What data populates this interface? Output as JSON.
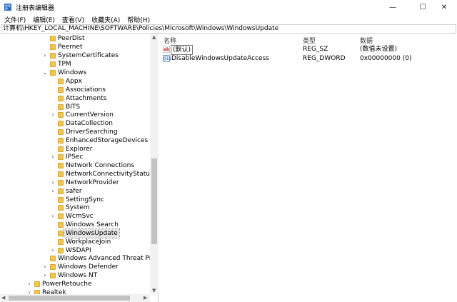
{
  "window": {
    "title": "注册表编辑器"
  },
  "window_controls": {
    "minimize": "—",
    "maximize": "☐",
    "close": "✕"
  },
  "menu": [
    "文件(F)",
    "编辑(E)",
    "查看(V)",
    "收藏夹(A)",
    "帮助(H)"
  ],
  "address": "计算机\\HKEY_LOCAL_MACHINE\\SOFTWARE\\Policies\\Microsoft\\Windows\\WindowsUpdate",
  "tree": {
    "items": [
      "PeerDist",
      "Peernet",
      "SystemCertificates",
      "TPM",
      "Windows",
      "Appx",
      "Associations",
      "Attachments",
      "BITS",
      "CurrentVersion",
      "DataCollection",
      "DriverSearching",
      "EnhancedStorageDevices",
      "Explorer",
      "IPSec",
      "Network Connections",
      "NetworkConnectivityStatusInd",
      "NetworkProvider",
      "safer",
      "SettingSync",
      "System",
      "WcmSvc",
      "Windows Search",
      "WindowsUpdate",
      "WorkplaceJoin",
      "WSDAPI",
      "Windows Advanced Threat Prote",
      "Windows Defender",
      "Windows NT",
      "PowerRetouche",
      "Realtek"
    ]
  },
  "columns": {
    "name": "名称",
    "type": "类型",
    "data": "数据"
  },
  "values": [
    {
      "icon": "string-value-icon",
      "glyph": "ab",
      "name": "(默认)",
      "type": "REG_SZ",
      "data": "(数值未设置)"
    },
    {
      "icon": "binary-value-icon",
      "glyph": "011",
      "name": "DisableWindowsUpdateAccess",
      "type": "REG_DWORD",
      "data": "0x00000000 (0)"
    }
  ]
}
